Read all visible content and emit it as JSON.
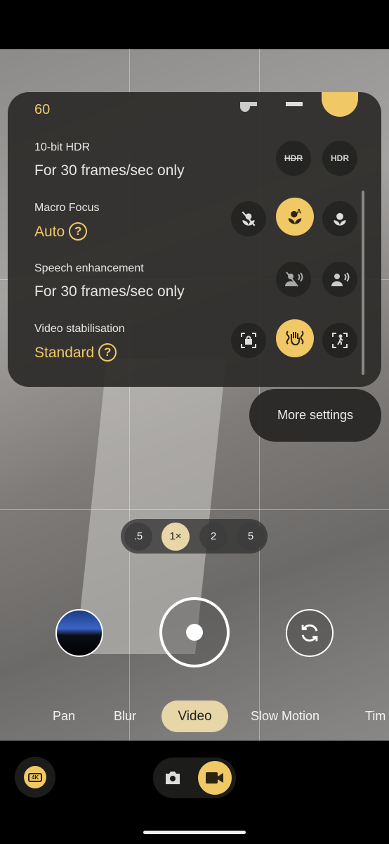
{
  "settings_panel": {
    "frame_rate_value": "60",
    "rows": [
      {
        "label": "10-bit HDR",
        "value": "For 30 frames/sec only",
        "icons": [
          "hdr-off-icon",
          "hdr-on-icon"
        ],
        "selected": null
      },
      {
        "label": "Macro Focus",
        "value": "Auto",
        "icons": [
          "macro-off-icon",
          "macro-auto-icon",
          "macro-on-icon"
        ],
        "selected": 1
      },
      {
        "label": "Speech enhancement",
        "value": "For 30 frames/sec only",
        "icons": [
          "speech-off-icon",
          "speech-on-icon"
        ],
        "selected": null
      },
      {
        "label": "Video stabilisation",
        "value": "Standard",
        "icons": [
          "locked-stabilisation-icon",
          "standard-stabilisation-icon",
          "active-stabilisation-icon"
        ],
        "selected": 1
      }
    ],
    "help": "?",
    "hdr_text": "HDR"
  },
  "more_settings": "More settings",
  "zoom": {
    "options": [
      ".5",
      "1×",
      "2",
      "5"
    ],
    "selected": 1
  },
  "modes": {
    "items": [
      "Pan",
      "Blur",
      "Video",
      "Slow Motion",
      "Tim"
    ],
    "selected": "Video"
  },
  "bottom": {
    "resolution": "4K",
    "mode_switch": [
      "photo",
      "video"
    ],
    "selected": "video"
  },
  "colors": {
    "accent": "#f0c866",
    "panel": "#2c2b29",
    "selected_pill": "#e6d6a8"
  }
}
